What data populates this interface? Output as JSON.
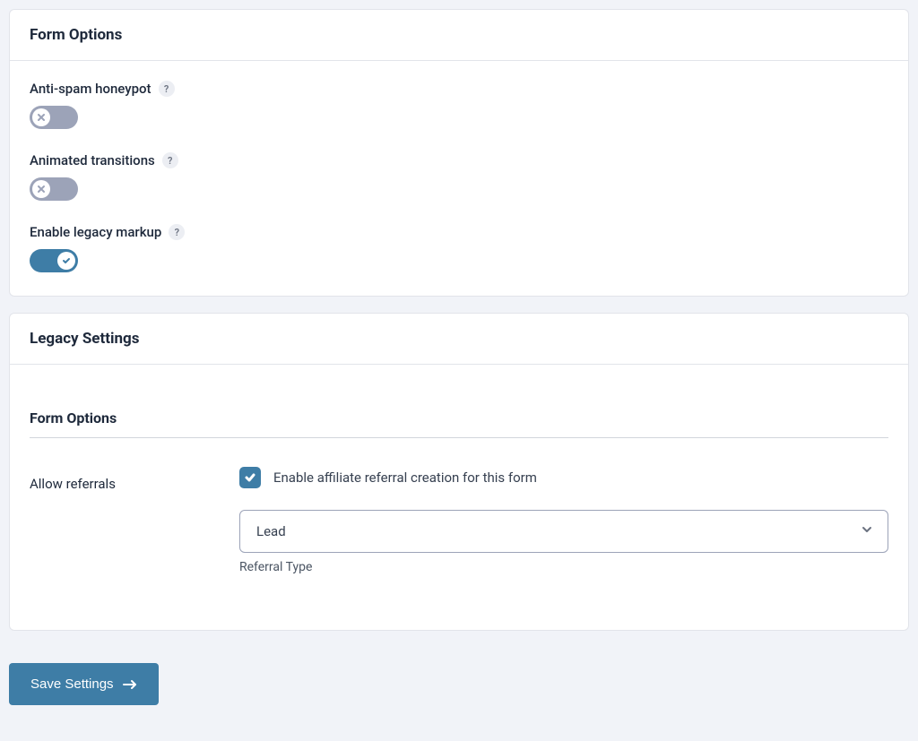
{
  "panels": {
    "form_options": {
      "title": "Form Options",
      "settings": {
        "honeypot": {
          "label": "Anti-spam honeypot",
          "help": "?",
          "value": false
        },
        "transitions": {
          "label": "Animated transitions",
          "help": "?",
          "value": false
        },
        "legacy_markup": {
          "label": "Enable legacy markup",
          "help": "?",
          "value": true
        }
      }
    },
    "legacy": {
      "title": "Legacy Settings",
      "subheading": "Form Options",
      "allow_referrals": {
        "label": "Allow referrals",
        "checkbox_label": "Enable affiliate referral creation for this form",
        "checked": true,
        "referral_type": {
          "selected": "Lead",
          "sublabel": "Referral Type"
        }
      }
    }
  },
  "actions": {
    "save": "Save Settings"
  },
  "colors": {
    "accent": "#3e7da6",
    "toggle_off": "#9ca3b8",
    "page_bg": "#f1f3f8"
  }
}
